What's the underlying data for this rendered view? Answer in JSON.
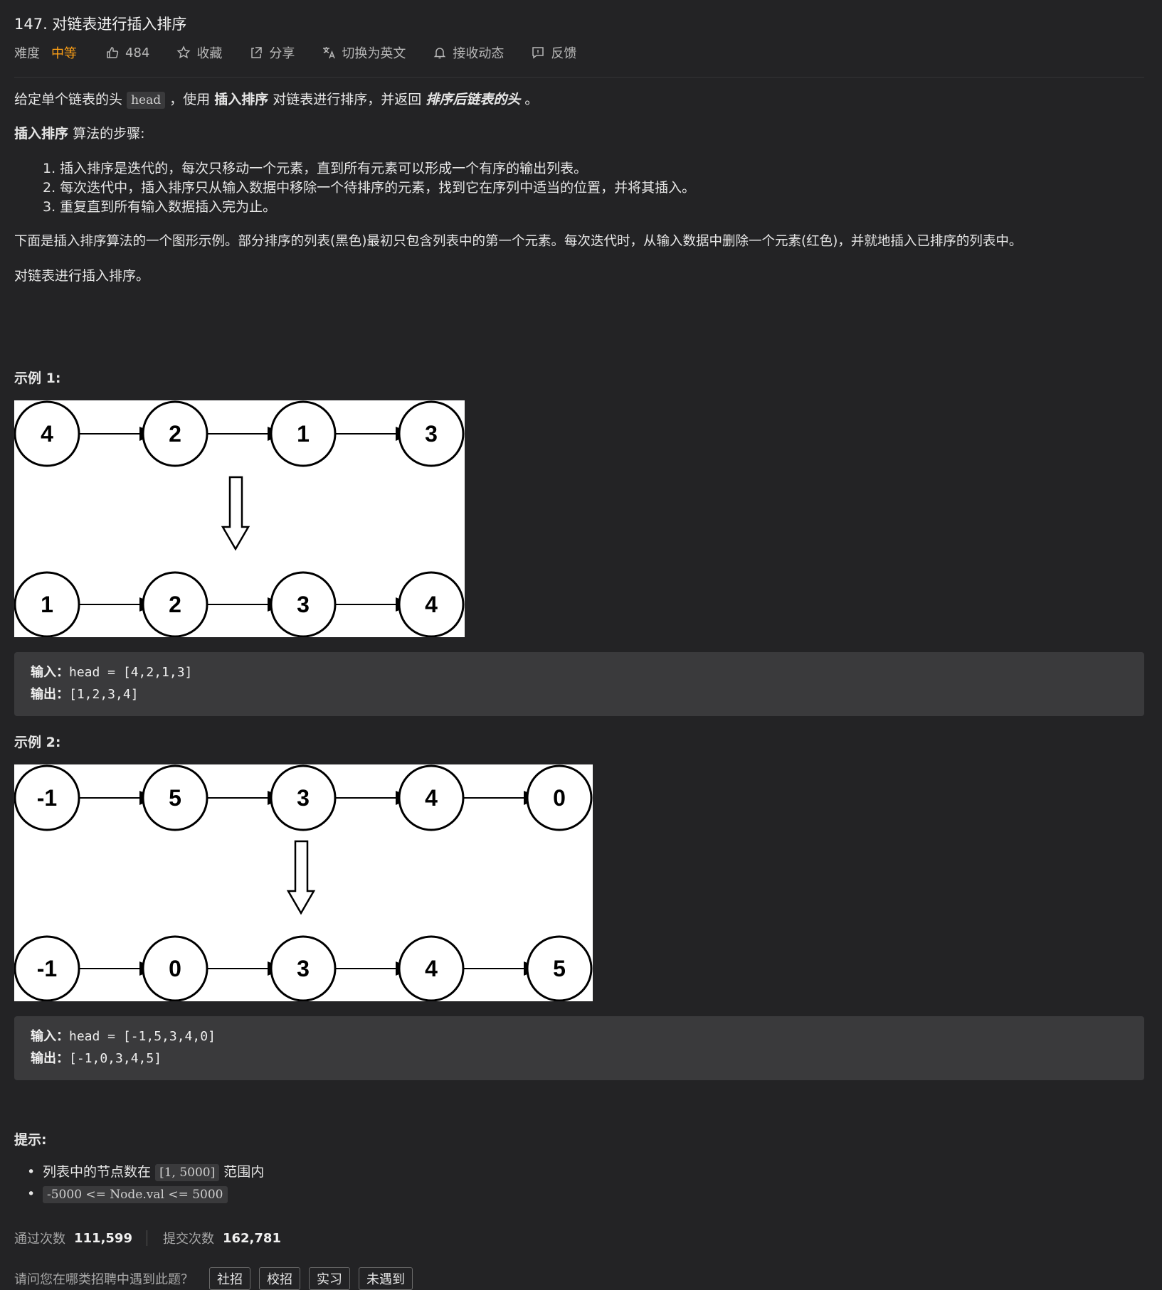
{
  "problem": {
    "title": "147. 对链表进行插入排序",
    "difficulty_label": "难度",
    "difficulty": "中等",
    "likes": "484",
    "favorite": "收藏",
    "share": "分享",
    "switch_lang": "切换为英文",
    "subscribe": "接收动态",
    "feedback": "反馈"
  },
  "description": {
    "p1_a": "给定单个链表的头",
    "p1_code": "head",
    "p1_b": "，使用",
    "p1_bold": "插入排序",
    "p1_c": "对链表进行排序，并返回",
    "p1_em": "排序后链表的头",
    "p1_d": "。",
    "p2_bold": "插入排序",
    "p2_rest": "算法的步骤:",
    "steps": [
      "1. 插入排序是迭代的，每次只移动一个元素，直到所有元素可以形成一个有序的输出列表。",
      "2. 每次迭代中，插入排序只从输入数据中移除一个待排序的元素，找到它在序列中适当的位置，并将其插入。",
      "3. 重复直到所有输入数据插入完为止。"
    ],
    "p3": "下面是插入排序算法的一个图形示例。部分排序的列表(黑色)最初只包含列表中的第一个元素。每次迭代时，从输入数据中删除一个元素(红色)，并就地插入已排序的列表中。",
    "p4": "对链表进行插入排序。"
  },
  "example1": {
    "heading": "示例 1:",
    "top_nodes": [
      "4",
      "2",
      "1",
      "3"
    ],
    "bottom_nodes": [
      "1",
      "2",
      "3",
      "4"
    ],
    "input_label": "输入：",
    "input_value": "head = [4,2,1,3]",
    "output_label": "输出：",
    "output_value": "[1,2,3,4]"
  },
  "example2": {
    "heading": "示例 2:",
    "top_nodes": [
      "-1",
      "5",
      "3",
      "4",
      "0"
    ],
    "bottom_nodes": [
      "-1",
      "0",
      "3",
      "4",
      "5"
    ],
    "input_label": "输入：",
    "input_value": "head = [-1,5,3,4,0]",
    "output_label": "输出：",
    "output_value": "[-1,0,3,4,5]"
  },
  "hints": {
    "heading": "提示:",
    "h1_a": "列表中的节点数在",
    "h1_code": "[1, 5000]",
    "h1_b": "范围内",
    "h2_code": "-5000 <= Node.val <= 5000"
  },
  "stats": {
    "accepted_label": "通过次数",
    "accepted": "111,599",
    "submissions_label": "提交次数",
    "submissions": "162,781"
  },
  "survey": {
    "question": "请问您在哪类招聘中遇到此题？",
    "options": [
      "社招",
      "校招",
      "实习",
      "未遇到"
    ]
  },
  "colors": {
    "accent": "#ffa116",
    "background": "#232325",
    "code_bg": "#3a3a3c"
  }
}
